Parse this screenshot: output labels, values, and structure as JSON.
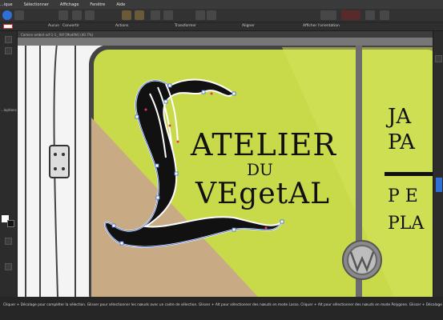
{
  "menu": [
    "...ique",
    "Sélectionner",
    "Affichage",
    "Fenêtre",
    "Aide"
  ],
  "context_bar": {
    "aucun": "Aucun",
    "convertir": "Convertir",
    "actions": "Actions",
    "transformer": "Transformer",
    "aligner": "Aligner",
    "afficher_orientation": "Afficher l'orientation"
  },
  "document_tab": "Camion ombré xcf-1-1_ 04f [Modifié] (40.7%)",
  "left_panel": {
    "label": "...loptions"
  },
  "logo": {
    "line1": "ATELIER",
    "line2": "DU",
    "line3": "VEgetAL"
  },
  "van_text": {
    "ja": "JA",
    "pa": "PA",
    "pe": "P E",
    "pla": "PLA"
  },
  "status_bar": "Cliquer + Décalage pour compléter la sélection. Glisser pour sélectionner les nœuds avec un cadre de sélection. Glisser + Alt pour sélectionner des nœuds en mode Lasso. Cliquer + Alt pour sélectionner des nœuds en mode Polygone. Glisser + Décalage pour ajouter des",
  "colors": {
    "lime": "#c8d94a",
    "kraft": "#c8ab84",
    "ink": "#111111",
    "selection": "#3f6fd8",
    "ui_dark": "#2b2b2b"
  }
}
